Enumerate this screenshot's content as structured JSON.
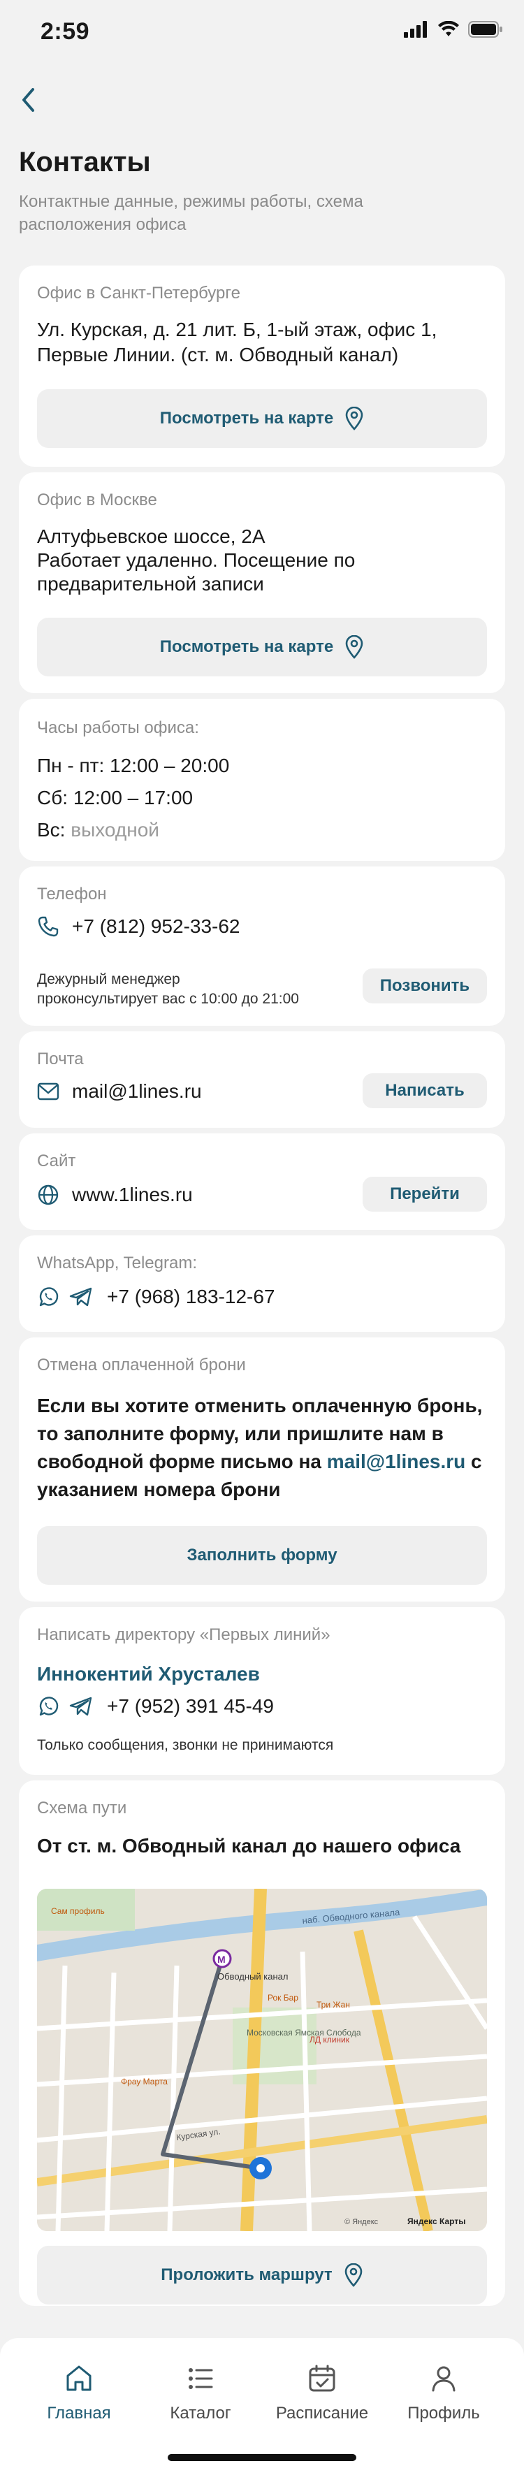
{
  "status": {
    "time": "2:59"
  },
  "page": {
    "title": "Контакты",
    "subtitle": "Контактные данные, режимы работы, схема расположения офиса"
  },
  "spb": {
    "label": "Офис в Санкт-Петербурге",
    "address_line1": "Ул. Курская, д. 21 лит. Б, 1-ый этаж, офис 1,",
    "address_line2": "Первые Линии. (ст. м. Обводный канал)",
    "button": "Посмотреть на карте"
  },
  "msk": {
    "label": "Офис в Москве",
    "line1": "Алтуфьевское шоссе, 2А",
    "line2": "Работает удаленно. Посещение по",
    "line3": "предварительной записи",
    "button": "Посмотреть на карте"
  },
  "hours": {
    "label": "Часы работы офиса:",
    "weekdays_label": "Пн - пт:",
    "weekdays_value": "12:00 – 20:00",
    "sat_label": "Сб:",
    "sat_value": "12:00 – 17:00",
    "sun_label": "Вс:",
    "sun_value": "выходной"
  },
  "phone": {
    "label": "Телефон",
    "number": "+7 (812) 952-33-62",
    "note_line1": "Дежурный менеджер",
    "note_line2": "проконсультирует вас с 10:00 до 21:00",
    "button": "Позвонить"
  },
  "mail": {
    "label": "Почта",
    "value": "mail@1lines.ru",
    "button": "Написать"
  },
  "site": {
    "label": "Сайт",
    "value": "www.1lines.ru",
    "button": "Перейти"
  },
  "messengers": {
    "label": "WhatsApp, Telegram:",
    "number": "+7 (968) 183-12-67"
  },
  "cancel": {
    "label": "Отмена оплаченной брони",
    "line1": "Если вы хотите отменить оплаченную бронь,",
    "line2": "то заполните форму, или пришлите нам в",
    "line3_prefix": "свободной форме письмо на ",
    "line3_link": "mail@1lines.ru",
    "line3_suffix": " с",
    "line4": "указанием номера брони",
    "button": "Заполнить форму"
  },
  "director": {
    "label": "Написать директору «Первых линий»",
    "name": "Иннокентий Хрусталев",
    "number": "+7 (952) 391 45-49",
    "note": "Только сообщения, звонки не принимаются"
  },
  "route": {
    "label": "Схема пути",
    "title": "От ст. м. Обводный канал до нашего офиса",
    "button": "Проложить маршрут",
    "map_labels": {
      "metro": "Обводный канал",
      "street1": "наб. Обводного канала",
      "street2": "Курская ул.",
      "poi1": "Рок Бар",
      "poi2": "Три Жан",
      "poi3": "ЛД клиник",
      "poi4": "Фрау Марта",
      "poi5": "Московская Ямская Слобода",
      "poi6": "Сам профиль",
      "attribution": "© Яндекс",
      "brand": "Яндекс Карты"
    }
  },
  "tabs": [
    {
      "label": "Главная"
    },
    {
      "label": "Каталог"
    },
    {
      "label": "Расписание"
    },
    {
      "label": "Профиль"
    }
  ],
  "colors": {
    "accent": "#1f5b73",
    "muted": "#8c8c8c",
    "card": "#ffffff",
    "background": "#f2f2f2"
  }
}
